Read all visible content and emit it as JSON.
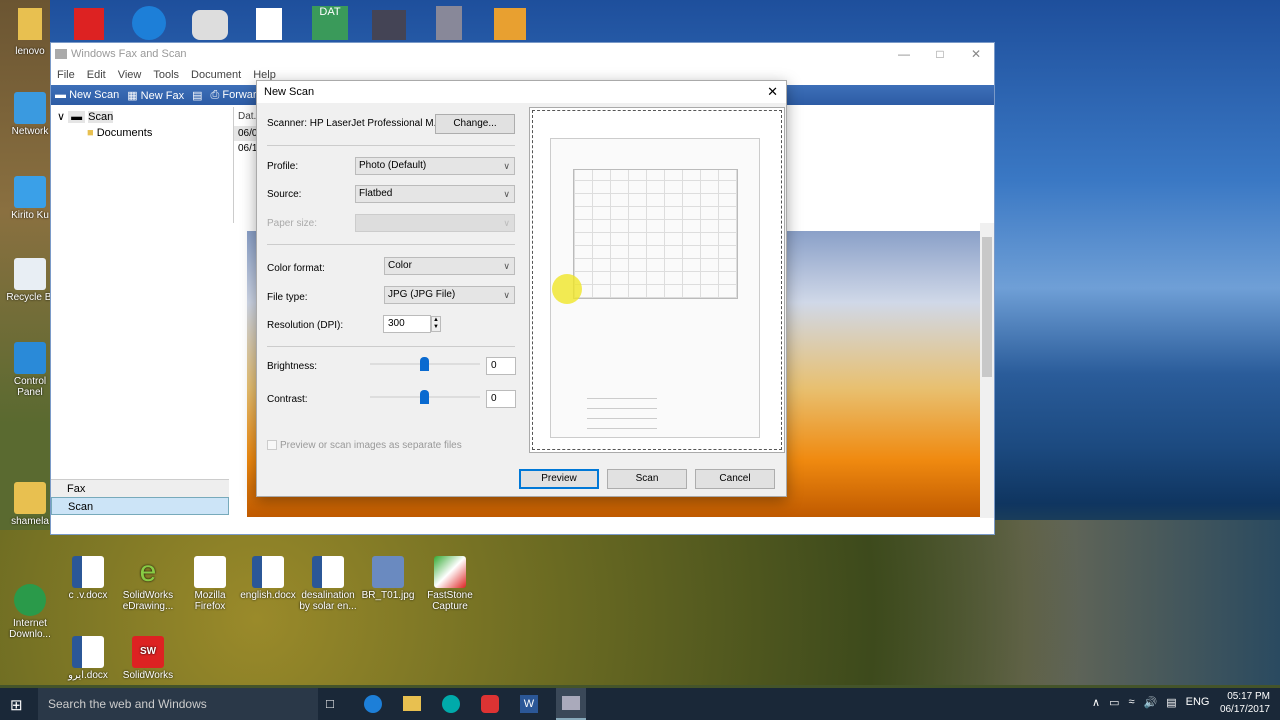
{
  "desktop": {
    "left_icons": [
      {
        "label": "lenovo"
      },
      {
        "label": "Network"
      },
      {
        "label": "Kirito Ku"
      },
      {
        "label": "Recycle Bi"
      },
      {
        "label": "Control Panel"
      },
      {
        "label": "shamela"
      },
      {
        "label": "Internet Downlo..."
      }
    ],
    "bottom_icons": [
      {
        "label": "c .v.docx"
      },
      {
        "label": "SolidWorks eDrawing..."
      },
      {
        "label": "Mozilla Firefox"
      },
      {
        "label": "english.docx"
      },
      {
        "label": "desalination by solar en..."
      },
      {
        "label": "BR_T01.jpg"
      },
      {
        "label": "FastStone Capture"
      },
      {
        "label": "ایرو.docx"
      },
      {
        "label": "SolidWorks"
      }
    ]
  },
  "fax_window": {
    "title": "Windows Fax and Scan",
    "menu": [
      "File",
      "Edit",
      "View",
      "Tools",
      "Document",
      "Help"
    ],
    "toolbar": {
      "new_scan": "New Scan",
      "new_fax": "New Fax",
      "forward": "Forward"
    },
    "tree": {
      "root": "Scan",
      "child": "Documents"
    },
    "list": {
      "header": "Dat...",
      "rows": [
        "06/0",
        "06/1"
      ]
    },
    "nav": {
      "fax": "Fax",
      "scan": "Scan"
    }
  },
  "dialog": {
    "title": "New Scan",
    "scanner_label": "Scanner: HP LaserJet Professional M...",
    "change_button": "Change...",
    "profile_label": "Profile:",
    "profile_value": "Photo (Default)",
    "source_label": "Source:",
    "source_value": "Flatbed",
    "paper_size_label": "Paper size:",
    "color_format_label": "Color format:",
    "color_format_value": "Color",
    "file_type_label": "File type:",
    "file_type_value": "JPG (JPG File)",
    "resolution_label": "Resolution (DPI):",
    "resolution_value": "300",
    "brightness_label": "Brightness:",
    "brightness_value": "0",
    "contrast_label": "Contrast:",
    "contrast_value": "0",
    "separate_files_label": "Preview or scan images as separate files",
    "preview_button": "Preview",
    "scan_button": "Scan",
    "cancel_button": "Cancel"
  },
  "taskbar": {
    "search_placeholder": "Search the web and Windows",
    "language": "ENG",
    "time": "05:17 PM",
    "date": "06/17/2017"
  }
}
